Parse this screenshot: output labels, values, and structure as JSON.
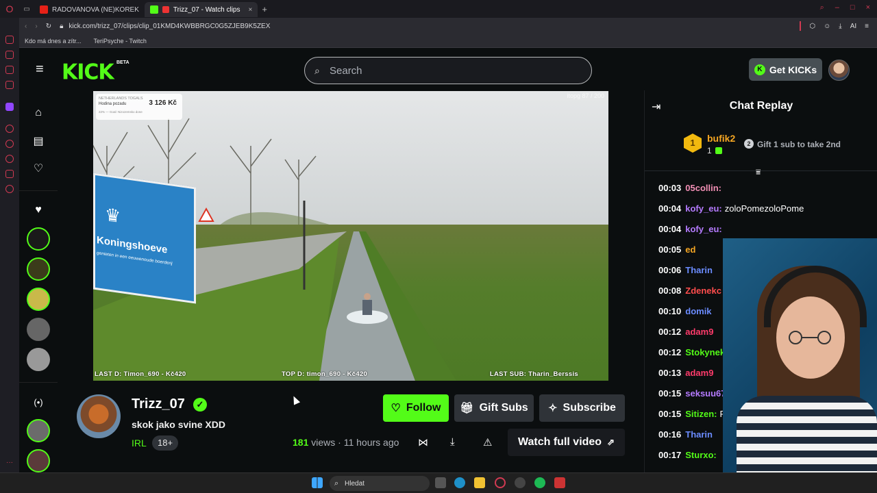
{
  "browser": {
    "tabs": [
      {
        "label": "RADOVANOVA (NE)KOREK",
        "active": false
      },
      {
        "label": "Trizz_07 - Watch clips",
        "active": true
      }
    ],
    "url": "kick.com/trizz_07/clips/clip_01KMD4KWBBRGC0G5ZJEB9K5ZEX",
    "bookmarks": [
      "Kdo má dnes a zítr...",
      "TeriPsyche - Twitch"
    ],
    "ai_label": "AI"
  },
  "header": {
    "logo": "KICK",
    "beta": "BETA",
    "search_placeholder": "Search",
    "get_kicks": "Get KICKs"
  },
  "video": {
    "overlay_box": {
      "top": "NETHERLANDS TOGALS",
      "sub": "Hodina pozadu",
      "amount": "3 126 Kč",
      "goal": "22% — Goal: Nizozemsko done"
    },
    "top_right": "itopg   87 / 200",
    "sign_text": "Koningshoeve",
    "sign_sub": "genieten in een eeuwenoude boerderij",
    "last_donation": "LAST D: Timon_690 - Kč420",
    "top_donation": "TOP D: timon_690 - Kč420",
    "last_sub": "LAST SUB: Tharin_Berssis"
  },
  "streamer": {
    "name": "Trizz_07",
    "clip_title": "skok jako svine XDD",
    "category": "IRL",
    "age_badge": "18+",
    "views_count": "181",
    "views_label": "views",
    "time_ago": "11 hours ago"
  },
  "buttons": {
    "follow": "Follow",
    "gift_subs": "Gift Subs",
    "subscribe": "Subscribe",
    "watch_full": "Watch full video"
  },
  "chat": {
    "title": "Chat Replay",
    "leader": {
      "name": "bufik2",
      "count": "1",
      "rank": "1"
    },
    "gift_prompt": "Gift 1 sub to take 2nd",
    "gift_rank": "2",
    "messages": [
      {
        "time": "00:03",
        "user": "05collin:",
        "text": "",
        "color": "#f28fb5"
      },
      {
        "time": "00:04",
        "user": "kofy_eu:",
        "text": "zoloPomezoloPome",
        "color": "#b57bff"
      },
      {
        "time": "00:04",
        "user": "kofy_eu:",
        "text": "",
        "color": "#b57bff"
      },
      {
        "time": "00:05",
        "user": "ed",
        "text": "",
        "color": "#f5a623"
      },
      {
        "time": "00:06",
        "user": "Tharin",
        "text": "",
        "color": "#6b8cff"
      },
      {
        "time": "00:08",
        "user": "Zdenekc",
        "text": "",
        "color": "#ff4d4d"
      },
      {
        "time": "00:10",
        "user": "domik",
        "text": "",
        "color": "#6b8cff"
      },
      {
        "time": "00:12",
        "user": "adam9",
        "text": "",
        "color": "#ff3b6b"
      },
      {
        "time": "00:12",
        "user": "Stokynek:",
        "text": "",
        "color": "#53fc18"
      },
      {
        "time": "00:13",
        "user": "adam9",
        "text": "",
        "color": "#ff3b6b"
      },
      {
        "time": "00:15",
        "user": "seksuu67",
        "text": "",
        "color": "#b57bff"
      },
      {
        "time": "00:15",
        "user": "Sitizen:",
        "text": "Po",
        "color": "#53fc18"
      },
      {
        "time": "00:16",
        "user": "Tharin",
        "text": "",
        "color": "#6b8cff"
      },
      {
        "time": "00:17",
        "user": "Sturxo:",
        "text": "",
        "color": "#53fc18"
      }
    ]
  },
  "taskbar": {
    "search": "Hledat"
  },
  "colors": {
    "accent": "#53fc18",
    "bg": "#0b0e0f",
    "button": "#2f3338"
  }
}
